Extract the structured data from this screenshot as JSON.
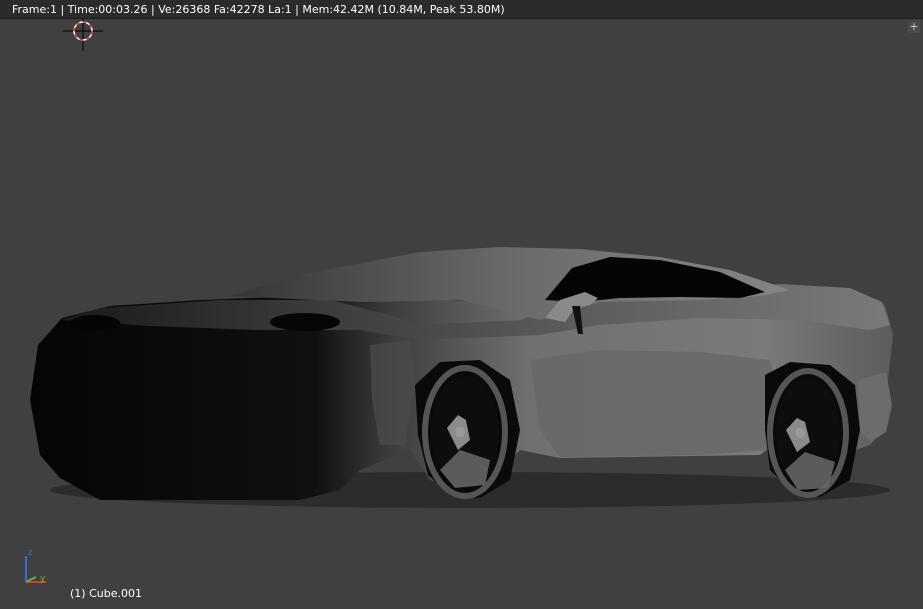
{
  "stats": {
    "text": "Frame:1 | Time:00:03.26 | Ve:26368 Fa:42278 La:1 | Mem:42.42M (10.84M, Peak 53.80M)"
  },
  "viewport": {
    "background": "#404040",
    "corner_button_icon": "plus-icon",
    "corner_button_glyph": "+",
    "object_label": "(1) Cube.001"
  },
  "axis_gizmo": {
    "z_label": "z",
    "y_label": "y",
    "colors": {
      "x": "#d43d3d",
      "y": "#66b529",
      "z": "#3b6ad9"
    }
  },
  "cursor": {
    "icon": "3d-cursor-icon"
  }
}
